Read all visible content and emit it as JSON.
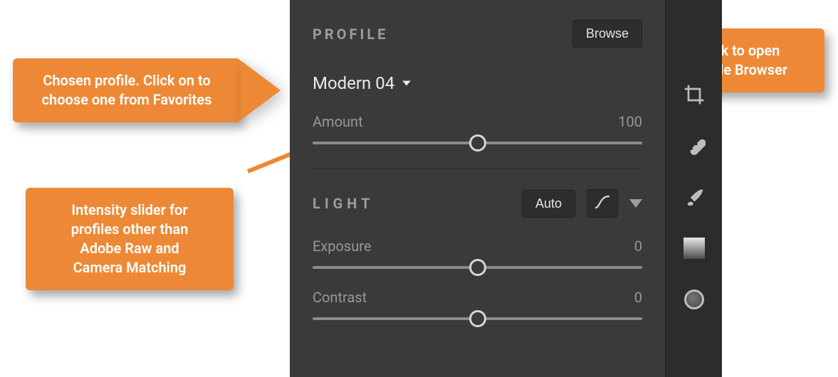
{
  "callouts": {
    "c1": "Chosen profile. Click on to\nchoose one from Favorites",
    "c2": "Click to open\nProfile Browser",
    "c3": "Intensity slider for\nprofiles other than\nAdobe Raw and\nCamera Matching"
  },
  "panel": {
    "profile_header": "PROFILE",
    "browse_label": "Browse",
    "profile_name": "Modern 04",
    "amount_label": "Amount",
    "amount_value": "100",
    "light_header": "LIGHT",
    "auto_label": "Auto",
    "exposure_label": "Exposure",
    "exposure_value": "0",
    "contrast_label": "Contrast",
    "contrast_value": "0"
  },
  "slider_positions": {
    "amount_pct": 50,
    "exposure_pct": 50,
    "contrast_pct": 50
  },
  "colors": {
    "annotation": "#ed8936",
    "panel_bg": "#3a3a3a",
    "rail_bg": "#2c2c2c"
  }
}
